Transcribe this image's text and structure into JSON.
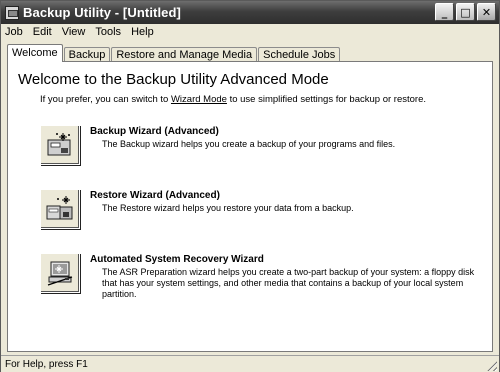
{
  "window": {
    "title": "Backup Utility - [Untitled]",
    "buttons": {
      "minimize": "_",
      "maximize": "□",
      "close": "✕"
    }
  },
  "menu": [
    "Job",
    "Edit",
    "View",
    "Tools",
    "Help"
  ],
  "tabs": [
    {
      "label": "Welcome",
      "active": true
    },
    {
      "label": "Backup",
      "active": false
    },
    {
      "label": "Restore and Manage Media",
      "active": false
    },
    {
      "label": "Schedule Jobs",
      "active": false
    }
  ],
  "welcome": {
    "title": "Welcome to the Backup Utility Advanced Mode",
    "intro_before": "If you prefer, you can switch to ",
    "intro_link": "Wizard Mode",
    "intro_after": " to use simplified settings for backup or restore."
  },
  "wizards": [
    {
      "icon": "backup-wizard-icon",
      "title": "Backup Wizard (Advanced)",
      "description": "The Backup wizard helps you create a backup of your programs and files."
    },
    {
      "icon": "restore-wizard-icon",
      "title": "Restore Wizard (Advanced)",
      "description": "The Restore wizard helps you restore your data from a backup."
    },
    {
      "icon": "asr-wizard-icon",
      "title": "Automated System Recovery Wizard",
      "description": "The ASR Preparation wizard helps you create a two-part backup of your system: a floppy disk that has your system settings, and other media that contains a backup of your local system partition."
    }
  ],
  "status": {
    "text": "For Help, press F1"
  }
}
